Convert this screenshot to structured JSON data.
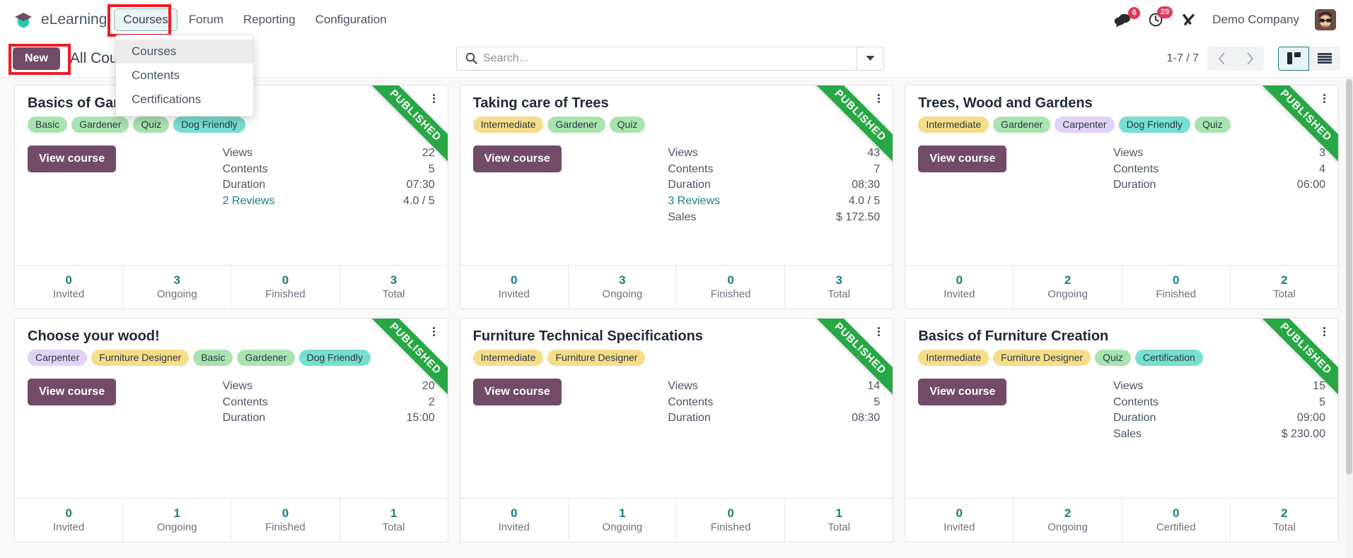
{
  "navbar": {
    "brand": "eLearning",
    "menu": [
      {
        "label": "Courses",
        "active": true
      },
      {
        "label": "Forum",
        "active": false
      },
      {
        "label": "Reporting",
        "active": false
      },
      {
        "label": "Configuration",
        "active": false
      }
    ],
    "messages_badge": "6",
    "activities_badge": "29",
    "company": "Demo Company",
    "icons": {
      "messages": "chat-bubble-icon",
      "activities": "clock-icon",
      "debug": "tools-icon",
      "avatar": "user-avatar"
    }
  },
  "dropdown": {
    "items": [
      {
        "label": "Courses",
        "hover": true
      },
      {
        "label": "Contents",
        "hover": false
      },
      {
        "label": "Certifications",
        "hover": false
      }
    ]
  },
  "control_panel": {
    "new_label": "New",
    "breadcrumb": "All Courses",
    "search_placeholder": "Search...",
    "search_value": "",
    "pager": "1-7 / 7",
    "prev_icon": "chevron-left-icon",
    "next_icon": "chevron-right-icon",
    "views": [
      {
        "name": "kanban-view",
        "active": true
      },
      {
        "name": "list-view",
        "active": false
      }
    ]
  },
  "labels": {
    "views": "Views",
    "contents": "Contents",
    "duration": "Duration",
    "sales": "Sales",
    "view_course": "View course",
    "published": "PUBLISHED"
  },
  "courses": [
    {
      "title": "Basics of Gardening",
      "tags": [
        {
          "label": "Basic",
          "color": "green"
        },
        {
          "label": "Gardener",
          "color": "green"
        },
        {
          "label": "Quiz",
          "color": "green"
        },
        {
          "label": "Dog Friendly",
          "color": "teal"
        }
      ],
      "published": true,
      "stats": [
        {
          "label": "Views",
          "value": "22",
          "link": false
        },
        {
          "label": "Contents",
          "value": "5",
          "link": false
        },
        {
          "label": "Duration",
          "value": "07:30",
          "link": false
        },
        {
          "label": "2 Reviews",
          "value": "4.0 / 5",
          "link": true
        }
      ],
      "footer": [
        {
          "value": "0",
          "label": "Invited"
        },
        {
          "value": "3",
          "label": "Ongoing"
        },
        {
          "value": "0",
          "label": "Finished"
        },
        {
          "value": "3",
          "label": "Total"
        }
      ]
    },
    {
      "title": "Taking care of Trees",
      "tags": [
        {
          "label": "Intermediate",
          "color": "yellow"
        },
        {
          "label": "Gardener",
          "color": "green"
        },
        {
          "label": "Quiz",
          "color": "green"
        }
      ],
      "published": true,
      "stats": [
        {
          "label": "Views",
          "value": "43",
          "link": false
        },
        {
          "label": "Contents",
          "value": "7",
          "link": false
        },
        {
          "label": "Duration",
          "value": "08:30",
          "link": false
        },
        {
          "label": "3 Reviews",
          "value": "4.0 / 5",
          "link": true
        },
        {
          "label": "Sales",
          "value": "$ 172.50",
          "link": false
        }
      ],
      "footer": [
        {
          "value": "0",
          "label": "Invited"
        },
        {
          "value": "3",
          "label": "Ongoing"
        },
        {
          "value": "0",
          "label": "Finished"
        },
        {
          "value": "3",
          "label": "Total"
        }
      ]
    },
    {
      "title": "Trees, Wood and Gardens",
      "tags": [
        {
          "label": "Intermediate",
          "color": "yellow"
        },
        {
          "label": "Gardener",
          "color": "green"
        },
        {
          "label": "Carpenter",
          "color": "purple"
        },
        {
          "label": "Dog Friendly",
          "color": "teal"
        },
        {
          "label": "Quiz",
          "color": "green"
        }
      ],
      "published": true,
      "stats": [
        {
          "label": "Views",
          "value": "3",
          "link": false
        },
        {
          "label": "Contents",
          "value": "4",
          "link": false
        },
        {
          "label": "Duration",
          "value": "06:00",
          "link": false
        }
      ],
      "footer": [
        {
          "value": "0",
          "label": "Invited"
        },
        {
          "value": "2",
          "label": "Ongoing"
        },
        {
          "value": "0",
          "label": "Finished"
        },
        {
          "value": "2",
          "label": "Total"
        }
      ]
    },
    {
      "title": "Choose your wood!",
      "tags": [
        {
          "label": "Carpenter",
          "color": "purple"
        },
        {
          "label": "Furniture Designer",
          "color": "yellow"
        },
        {
          "label": "Basic",
          "color": "green"
        },
        {
          "label": "Gardener",
          "color": "green"
        },
        {
          "label": "Dog Friendly",
          "color": "teal"
        }
      ],
      "published": true,
      "stats": [
        {
          "label": "Views",
          "value": "20",
          "link": false
        },
        {
          "label": "Contents",
          "value": "2",
          "link": false
        },
        {
          "label": "Duration",
          "value": "15:00",
          "link": false
        }
      ],
      "footer": [
        {
          "value": "0",
          "label": "Invited"
        },
        {
          "value": "1",
          "label": "Ongoing"
        },
        {
          "value": "0",
          "label": "Finished"
        },
        {
          "value": "1",
          "label": "Total"
        }
      ]
    },
    {
      "title": "Furniture Technical Specifications",
      "tags": [
        {
          "label": "Intermediate",
          "color": "yellow"
        },
        {
          "label": "Furniture Designer",
          "color": "yellow"
        }
      ],
      "published": true,
      "stats": [
        {
          "label": "Views",
          "value": "14",
          "link": false
        },
        {
          "label": "Contents",
          "value": "5",
          "link": false
        },
        {
          "label": "Duration",
          "value": "08:30",
          "link": false
        }
      ],
      "footer": [
        {
          "value": "0",
          "label": "Invited"
        },
        {
          "value": "1",
          "label": "Ongoing"
        },
        {
          "value": "0",
          "label": "Finished"
        },
        {
          "value": "1",
          "label": "Total"
        }
      ]
    },
    {
      "title": "Basics of Furniture Creation",
      "tags": [
        {
          "label": "Intermediate",
          "color": "yellow"
        },
        {
          "label": "Furniture Designer",
          "color": "yellow"
        },
        {
          "label": "Quiz",
          "color": "green"
        },
        {
          "label": "Certification",
          "color": "teal"
        }
      ],
      "published": true,
      "stats": [
        {
          "label": "Views",
          "value": "15",
          "link": false
        },
        {
          "label": "Contents",
          "value": "5",
          "link": false
        },
        {
          "label": "Duration",
          "value": "09:00",
          "link": false
        },
        {
          "label": "Sales",
          "value": "$ 230.00",
          "link": false
        }
      ],
      "footer": [
        {
          "value": "0",
          "label": "Invited"
        },
        {
          "value": "2",
          "label": "Ongoing"
        },
        {
          "value": "0",
          "label": "Certified"
        },
        {
          "value": "2",
          "label": "Total"
        }
      ]
    }
  ],
  "colors": {
    "primary": "#714b67",
    "accent": "#1f7c7c",
    "published": "#28a745",
    "badge": "#e2385a"
  }
}
